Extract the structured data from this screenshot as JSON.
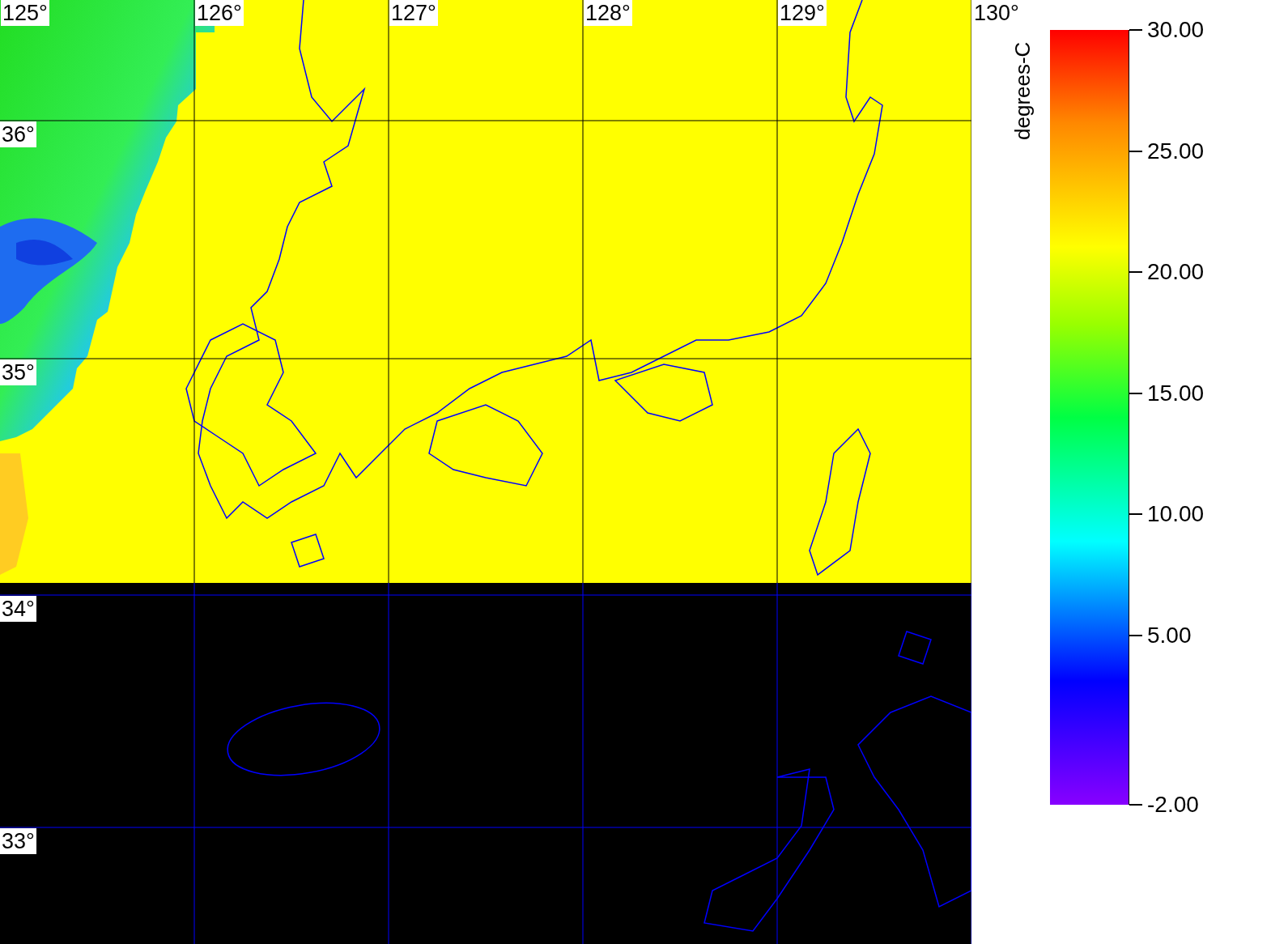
{
  "map": {
    "lon_labels": [
      "125°",
      "126°",
      "127°",
      "128°",
      "129°",
      "130°"
    ],
    "lat_labels": [
      "36°",
      "35°",
      "34°",
      "33°"
    ]
  },
  "legend": {
    "title": "degrees-C",
    "ticks": [
      "30.00",
      "25.00",
      "20.00",
      "15.00",
      "10.00",
      "5.00",
      "-2.00"
    ]
  }
}
